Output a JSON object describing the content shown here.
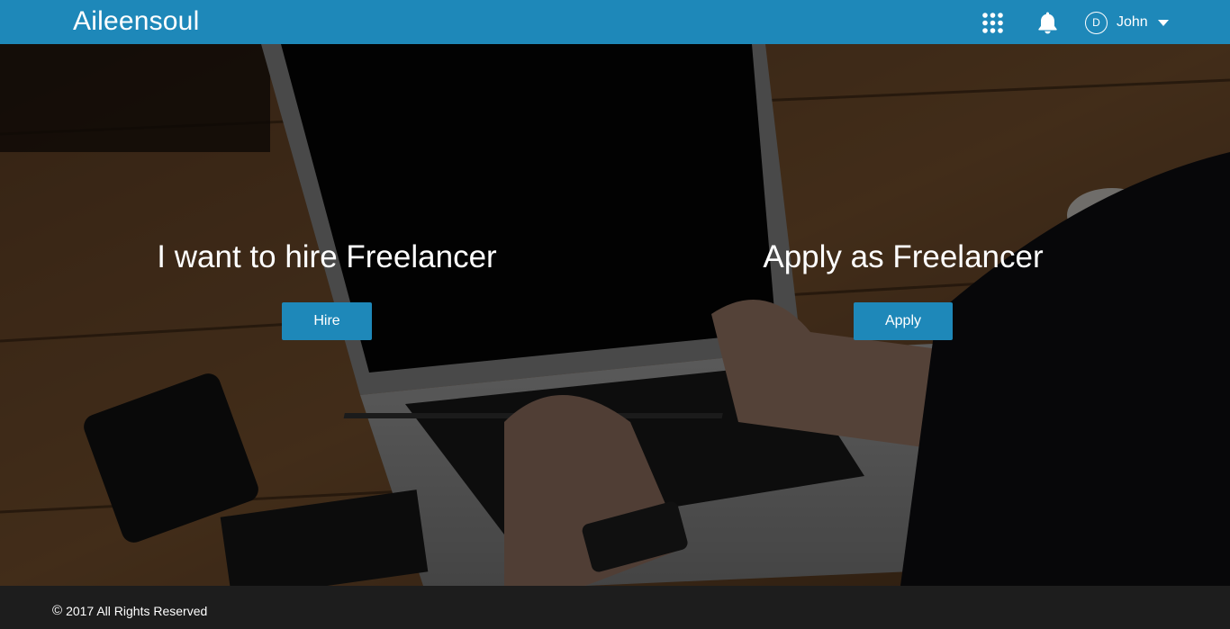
{
  "header": {
    "brand": "Aileensoul",
    "apps_icon": "apps-grid-icon",
    "notification_icon": "bell-icon",
    "user": {
      "avatar_initial": "D",
      "name": "John",
      "menu_icon": "caret-down-icon"
    }
  },
  "hero": {
    "hire": {
      "title": "I want to hire Freelancer",
      "button_label": "Hire"
    },
    "apply": {
      "title": "Apply as Freelancer",
      "button_label": "Apply"
    }
  },
  "footer": {
    "copyright_symbol": "©",
    "copyright_text": "2017 All Rights Reserved"
  },
  "colors": {
    "brand_blue": "#1e88b9",
    "footer_bg": "#1d1d1d"
  }
}
